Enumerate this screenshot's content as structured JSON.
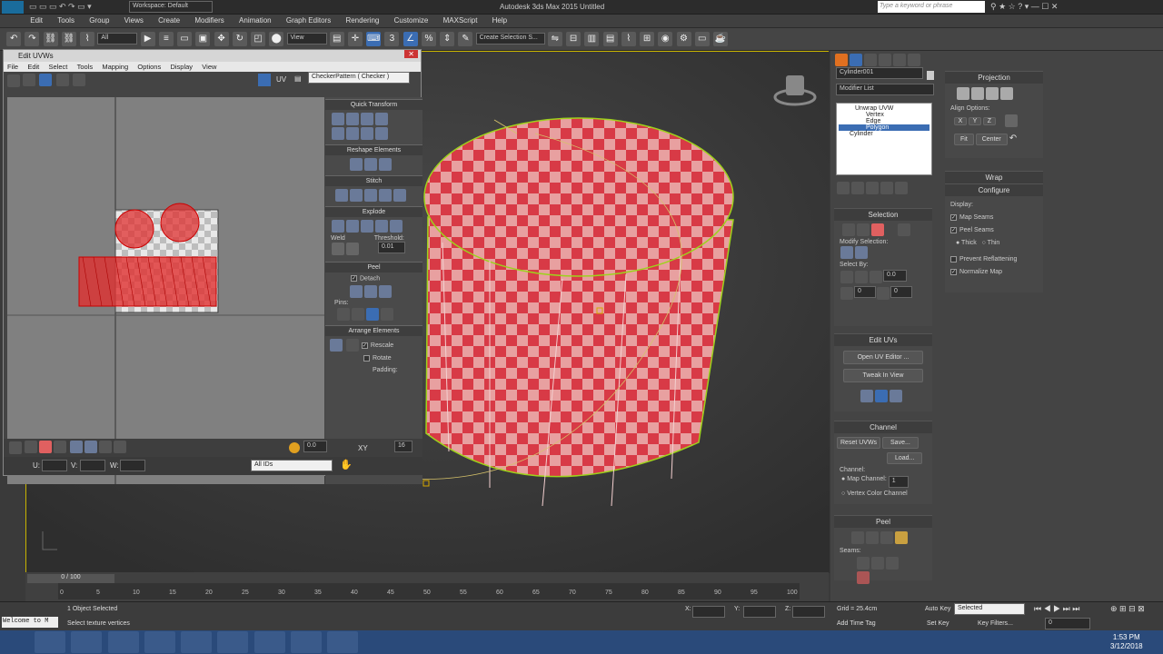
{
  "titlebar": {
    "workspace": "Workspace: Default",
    "title": "Autodesk 3ds Max 2015    Untitled",
    "search_placeholder": "Type a keyword or phrase"
  },
  "menu": [
    "Edit",
    "Tools",
    "Group",
    "Views",
    "Create",
    "Modifiers",
    "Animation",
    "Graph Editors",
    "Rendering",
    "Customize",
    "MAXScript",
    "Help"
  ],
  "toolbar": {
    "filter": "All",
    "view": "View",
    "selection_set": "Create Selection S..."
  },
  "uvw": {
    "title": "Edit UVWs",
    "menu": [
      "File",
      "Edit",
      "Select",
      "Tools",
      "Mapping",
      "Options",
      "Display",
      "View"
    ],
    "uv_label": "UV",
    "texture": "CheckerPattern  ( Checker )",
    "panels": {
      "quick_transform": "Quick Transform",
      "reshape": "Reshape Elements",
      "stitch": "Stitch",
      "explode": "Explode",
      "weld": "Weld",
      "threshold_label": "Threshold:",
      "threshold": "0.01",
      "peel": "Peel",
      "detach": "Detach",
      "pins": "Pins:",
      "arrange": "Arrange Elements",
      "rescale": "Rescale",
      "rotate": "Rotate",
      "padding": "Padding:"
    },
    "bottom": {
      "value1": "0.0",
      "xy": "XY",
      "num": "16",
      "u": "U:",
      "v": "V:",
      "w": "W:",
      "ids": "All IDs"
    }
  },
  "command": {
    "object_name": "Cylinder001",
    "modifier_list": "Modifier List",
    "stack": [
      "Unwrap UVW",
      "Vertex",
      "Edge",
      "Polygon",
      "Cylinder"
    ],
    "projection": "Projection",
    "align_options": "Align Options:",
    "align_x": "X",
    "align_y": "Y",
    "align_z": "Z",
    "fit": "Fit",
    "center": "Center",
    "wrap": "Wrap",
    "configure": "Configure",
    "display": "Display:",
    "map_seams": "Map Seams",
    "peel_seams": "Peel Seams",
    "thick": "Thick",
    "thin": "Thin",
    "prevent_reflattening": "Prevent Reflattening",
    "normalize_map": "Normalize Map",
    "selection": "Selection",
    "modify_selection": "Modify Selection:",
    "select_by": "Select By:",
    "sel_val1": "0.0",
    "sel_val2": "0",
    "sel_val3": "0",
    "edit_uvs": "Edit UVs",
    "open_uv_editor": "Open UV Editor ...",
    "tweak_in_view": "Tweak In View",
    "channel": "Channel",
    "reset_uvws": "Reset UVWs",
    "save": "Save...",
    "load": "Load...",
    "channel_label": "Channel:",
    "map_channel": "Map Channel:",
    "map_channel_val": "1",
    "vertex_color_channel": "Vertex Color Channel",
    "peel": "Peel",
    "seams": "Seams:"
  },
  "timeline": {
    "frame": "0 / 100",
    "ticks": [
      "0",
      "5",
      "10",
      "15",
      "20",
      "25",
      "30",
      "35",
      "40",
      "45",
      "50",
      "55",
      "60",
      "65",
      "70",
      "75",
      "80",
      "85",
      "90",
      "95",
      "100"
    ]
  },
  "status": {
    "welcome": "Welcome to M",
    "selected": "1 Object Selected",
    "prompt": "Select texture vertices",
    "x": "X:",
    "y": "Y:",
    "z": "Z:",
    "grid": "Grid = 25.4cm",
    "add_time_tag": "Add Time Tag",
    "auto_key": "Auto Key",
    "set_key": "Set Key",
    "key_sel": "Selected",
    "key_filters": "Key Filters...",
    "frame_val": "0"
  },
  "clock": {
    "time": "1:53 PM",
    "date": "3/12/2018"
  }
}
